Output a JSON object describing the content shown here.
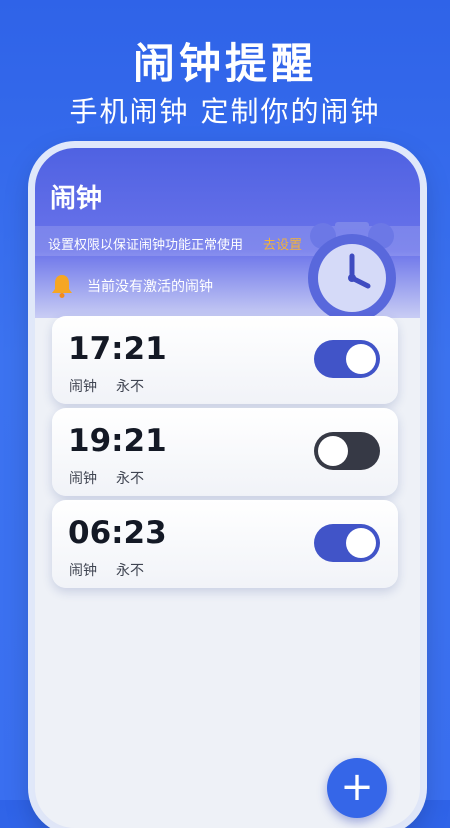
{
  "promo": {
    "headline": "闹钟提醒",
    "subline": "手机闹钟 定制你的闹钟"
  },
  "app": {
    "title": "闹钟",
    "permission_text": "设置权限以保证闹钟功能正常使用",
    "permission_link": "去设置",
    "status_text": "当前没有激活的闹钟"
  },
  "alarms": [
    {
      "time": "17:21",
      "label": "闹钟",
      "repeat": "永不",
      "enabled": true
    },
    {
      "time": "19:21",
      "label": "闹钟",
      "repeat": "永不",
      "enabled": false
    },
    {
      "time": "06:23",
      "label": "闹钟",
      "repeat": "永不",
      "enabled": true
    }
  ],
  "fab_label": "+",
  "icons": {
    "bell": "bell-icon",
    "clock": "alarm-clock-icon",
    "add": "plus-icon"
  },
  "colors": {
    "accent": "#4154c8",
    "link": "#f2b23a",
    "toggle_off": "#363945"
  }
}
